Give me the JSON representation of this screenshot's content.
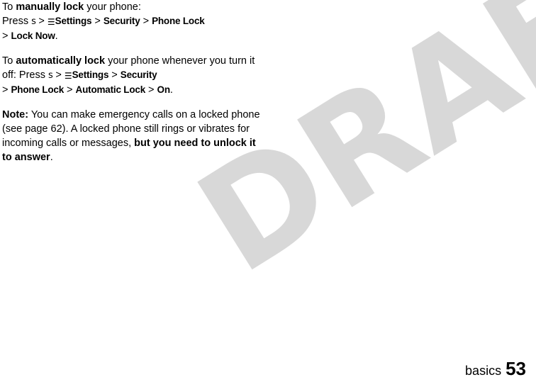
{
  "watermark": {
    "text": "DRAFT"
  },
  "paragraphs": {
    "p1": {
      "lead": "To ",
      "bold1": "manually lock",
      "mid1": " your phone:",
      "line2_lead": "Press ",
      "key_s": "s",
      "sep1": " > ",
      "icon_settings": "☰",
      "menu_settings": "Settings",
      "sep2": " > ",
      "menu_security": "Security",
      "sep3": " > ",
      "menu_phone_lock": "Phone Lock",
      "sep4": "> ",
      "menu_lock_now": "Lock Now",
      "end": "."
    },
    "p2": {
      "lead": "To ",
      "bold1": "automatically lock",
      "mid1": " your phone whenever you turn it off: Press ",
      "key_s": "s",
      "sep1": " > ",
      "icon_settings": "☰",
      "menu_settings": "Settings",
      "sep2": " > ",
      "menu_security": "Security",
      "sep3": "> ",
      "menu_phone_lock": "Phone Lock",
      "sep4": " > ",
      "menu_automatic_lock": "Automatic Lock",
      "sep5": " > ",
      "menu_on": "On",
      "end": "."
    },
    "p3": {
      "note_label": "Note:",
      "text1": " You can make emergency calls on a locked phone (see page 62). A locked phone still rings or vibrates for incoming calls or messages, ",
      "bold1": "but you need to unlock it to answer",
      "end": "."
    }
  },
  "footer": {
    "section": "basics",
    "page_number": "53"
  }
}
